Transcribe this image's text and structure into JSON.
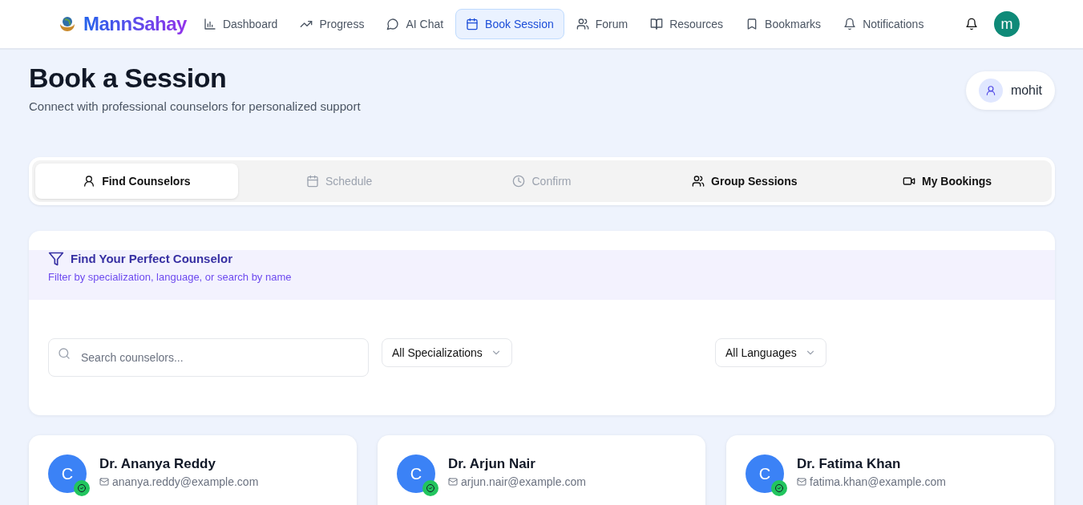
{
  "brand": {
    "name": "MannSahay"
  },
  "nav": [
    {
      "label": "Dashboard",
      "selected": false
    },
    {
      "label": "Progress",
      "selected": false
    },
    {
      "label": "AI Chat",
      "selected": false
    },
    {
      "label": "Book Session",
      "selected": true
    },
    {
      "label": "Forum",
      "selected": false
    },
    {
      "label": "Resources",
      "selected": false
    },
    {
      "label": "Bookmarks",
      "selected": false
    },
    {
      "label": "Notifications",
      "selected": false
    }
  ],
  "user_avatar": {
    "initial": "m"
  },
  "header": {
    "title": "Book a Session",
    "subtitle": "Connect with professional counselors for personalized support",
    "user": "mohit"
  },
  "tabs": [
    {
      "label": "Find Counselors",
      "selected": true,
      "disabled": false
    },
    {
      "label": "Schedule",
      "selected": false,
      "disabled": true
    },
    {
      "label": "Confirm",
      "selected": false,
      "disabled": true
    },
    {
      "label": "Group Sessions",
      "selected": false,
      "disabled": false
    },
    {
      "label": "My Bookings",
      "selected": false,
      "disabled": false
    }
  ],
  "filter": {
    "title": "Find Your Perfect Counselor",
    "subtitle": "Filter by specialization, language, or search by name",
    "search": {
      "placeholder": "Search counselors..."
    },
    "specialization": "All Specializations",
    "language": "All Languages"
  },
  "counselors": [
    {
      "initial": "C",
      "name": "Dr. Ananya Reddy",
      "email": "ananya.reddy@example.com",
      "verified": true
    },
    {
      "initial": "C",
      "name": "Dr. Arjun Nair",
      "email": "arjun.nair@example.com",
      "verified": true
    },
    {
      "initial": "C",
      "name": "Dr. Fatima Khan",
      "email": "fatima.khan@example.com",
      "verified": true
    }
  ]
}
